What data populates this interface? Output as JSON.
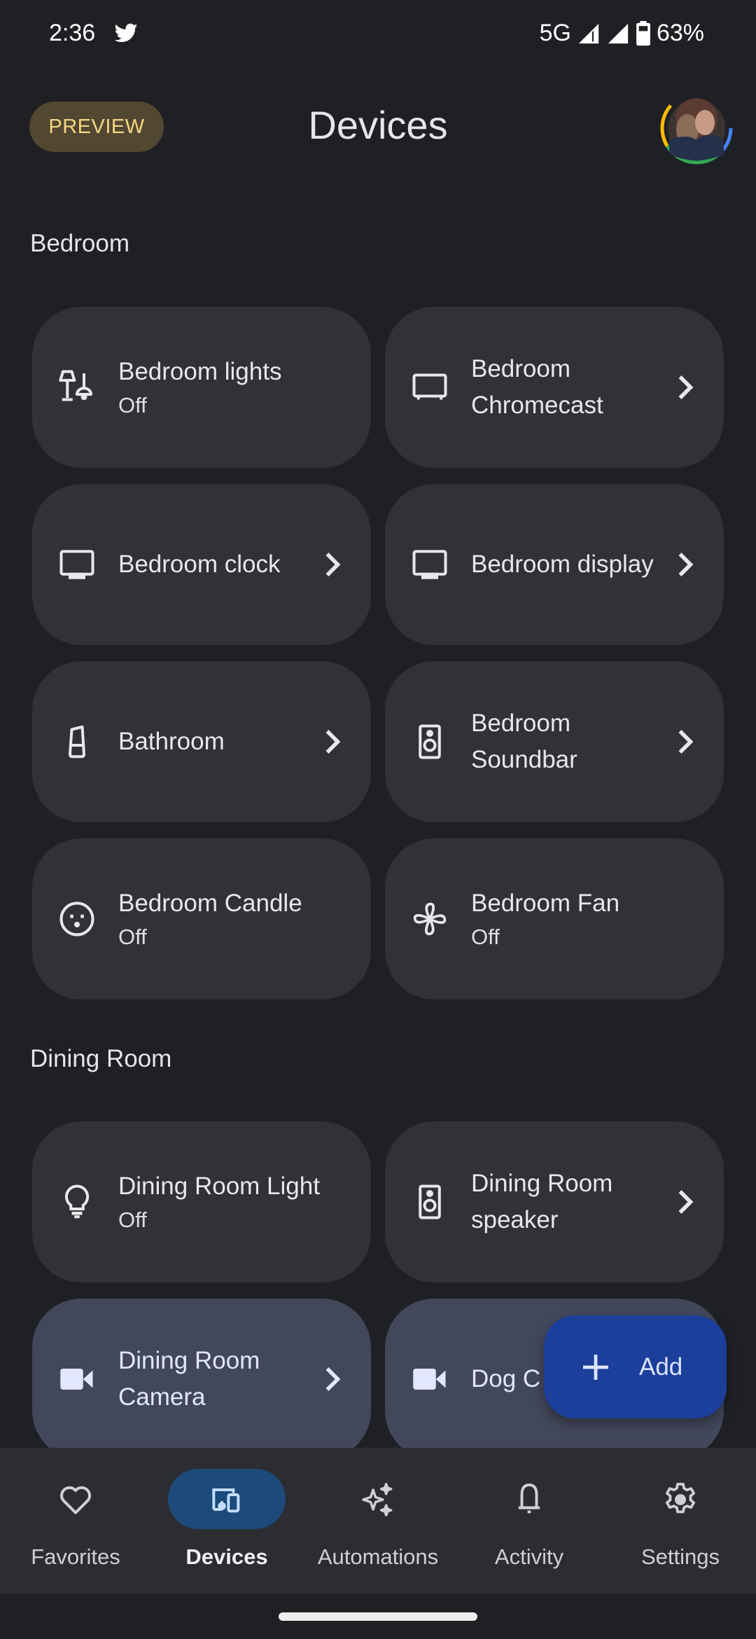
{
  "status_bar": {
    "time": "2:36",
    "notification_icon": "twitter-icon",
    "network": "5G",
    "battery": "63%"
  },
  "header": {
    "preview_badge": "PREVIEW",
    "title": "Devices",
    "avatar_icon": "account-avatar"
  },
  "sections": [
    {
      "title": "Bedroom",
      "devices": [
        {
          "name": "Bedroom lights",
          "state": "Off",
          "icon": "lamp-group-icon",
          "chevron": false
        },
        {
          "name": "Bedroom Chromecast",
          "state": "",
          "icon": "tv-icon",
          "chevron": true
        },
        {
          "name": "Bedroom clock",
          "state": "",
          "icon": "display-icon",
          "chevron": true
        },
        {
          "name": "Bedroom display",
          "state": "",
          "icon": "display-icon",
          "chevron": true
        },
        {
          "name": "Bathroom",
          "state": "",
          "icon": "smart-speaker-icon",
          "chevron": true
        },
        {
          "name": "Bedroom Soundbar",
          "state": "",
          "icon": "speaker-icon",
          "chevron": true
        },
        {
          "name": "Bedroom Candle",
          "state": "Off",
          "icon": "outlet-icon",
          "chevron": false
        },
        {
          "name": "Bedroom Fan",
          "state": "Off",
          "icon": "fan-icon",
          "chevron": false
        }
      ]
    },
    {
      "title": "Dining Room",
      "devices": [
        {
          "name": "Dining Room Light",
          "state": "Off",
          "icon": "lightbulb-icon",
          "chevron": false
        },
        {
          "name": "Dining Room speaker",
          "state": "",
          "icon": "speaker-icon",
          "chevron": true
        },
        {
          "name": "Dining Room Camera",
          "state": "",
          "icon": "videocam-icon",
          "chevron": true
        },
        {
          "name": "Dog C",
          "state": "",
          "icon": "videocam-icon",
          "chevron": false
        }
      ]
    }
  ],
  "fab": {
    "label": "Add",
    "icon": "plus-icon"
  },
  "bottom_nav": [
    {
      "label": "Favorites",
      "icon": "heart-icon",
      "active": false
    },
    {
      "label": "Devices",
      "icon": "devices-icon",
      "active": true
    },
    {
      "label": "Automations",
      "icon": "sparkle-icon",
      "active": false
    },
    {
      "label": "Activity",
      "icon": "bell-icon",
      "active": false
    },
    {
      "label": "Settings",
      "icon": "gear-icon",
      "active": false
    }
  ],
  "colors": {
    "background": "#1f2024",
    "card": "#313237",
    "camera_card": "#42475a",
    "fab": "#1b3f9a",
    "nav_active": "#1c4a7a",
    "preview_bg": "#524731",
    "preview_text": "#f4d882"
  }
}
